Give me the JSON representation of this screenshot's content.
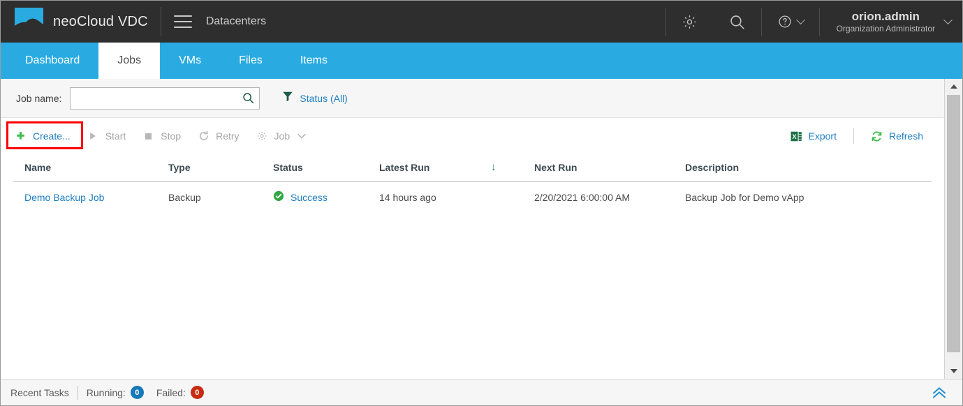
{
  "header": {
    "logo_icon": "cloud-logo-icon",
    "brand": "neoCloud VDC",
    "menu_icon": "hamburger-menu-icon",
    "context_title": "Datacenters",
    "settings_icon": "gear-icon",
    "search_icon": "search-icon",
    "help_icon": "help-question-icon",
    "user": {
      "name": "orion.admin",
      "role": "Organization Administrator",
      "caret_icon": "chevron-down-icon"
    }
  },
  "tabs": [
    {
      "label": "Dashboard",
      "active": false
    },
    {
      "label": "Jobs",
      "active": true
    },
    {
      "label": "VMs",
      "active": false
    },
    {
      "label": "Files",
      "active": false
    },
    {
      "label": "Items",
      "active": false
    }
  ],
  "filterbar": {
    "label": "Job name:",
    "search_value": "",
    "search_placeholder": "",
    "search_icon": "search-icon",
    "filter_icon": "funnel-filter-icon",
    "status_filter_label": "Status (All)"
  },
  "toolbar": {
    "create_label": "Create...",
    "create_icon": "plus-icon",
    "start_label": "Start",
    "start_icon": "play-icon",
    "stop_label": "Stop",
    "stop_icon": "stop-square-icon",
    "retry_label": "Retry",
    "retry_icon": "retry-arrow-icon",
    "job_label": "Job",
    "job_icon": "gear-icon",
    "job_caret_icon": "chevron-down-icon",
    "export_label": "Export",
    "export_icon": "excel-export-icon",
    "refresh_label": "Refresh",
    "refresh_icon": "refresh-icon",
    "highlight_color": "#ff0000"
  },
  "table": {
    "columns": [
      "Name",
      "Type",
      "Status",
      "Latest Run",
      "Next Run",
      "Description"
    ],
    "sort_indicator": "↓",
    "sort_column": "Latest Run",
    "rows": [
      {
        "name": "Demo Backup Job",
        "type": "Backup",
        "status": "Success",
        "status_icon": "success-check-icon",
        "latest_run": "14 hours ago",
        "next_run": "2/20/2021 6:00:00 AM",
        "description": "Backup Job for Demo vApp"
      }
    ]
  },
  "scrollbar": {
    "up_icon": "scroll-up-arrow-icon",
    "down_icon": "scroll-down-arrow-icon"
  },
  "footer": {
    "recent_tasks_label": "Recent Tasks",
    "running_label": "Running:",
    "running_count": "0",
    "failed_label": "Failed:",
    "failed_count": "0",
    "expand_icon": "double-chevron-up-icon"
  },
  "colors": {
    "accent_blue": "#29abe2",
    "link_blue": "#1f7ec2",
    "topbar_dark": "#2e2e2e",
    "success_green": "#31a843",
    "running_badge": "#1878b9",
    "failed_badge": "#c72c11"
  }
}
